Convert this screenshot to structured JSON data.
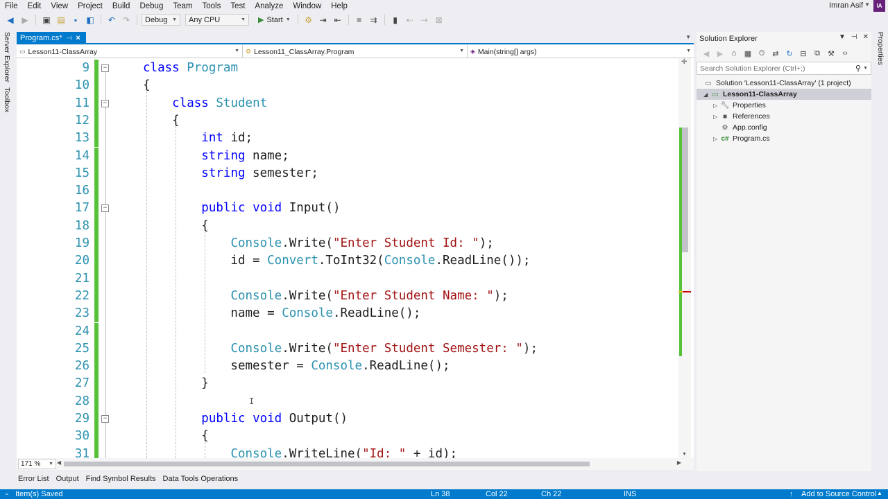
{
  "menu": [
    "File",
    "Edit",
    "View",
    "Project",
    "Build",
    "Debug",
    "Team",
    "Tools",
    "Test",
    "Analyze",
    "Window",
    "Help"
  ],
  "user": {
    "name": "Imran Asif",
    "initials": "IA"
  },
  "toolbar": {
    "config": "Debug",
    "platform": "Any CPU",
    "start": "Start"
  },
  "side_tabs": {
    "left": [
      "Server Explorer",
      "Toolbox"
    ],
    "right": "Properties"
  },
  "document_tab": {
    "label": "Program.cs*"
  },
  "navbar": {
    "project": "Lesson11-ClassArray",
    "type": "Lesson11_ClassArray.Program",
    "member": "Main(string[] args)"
  },
  "editor": {
    "lines": [
      {
        "n": "9",
        "tokens": [
          [
            "kw",
            "class"
          ],
          [
            "t",
            " "
          ],
          [
            "ty",
            "Program"
          ]
        ]
      },
      {
        "n": "10",
        "tokens": [
          [
            "t",
            "{"
          ]
        ]
      },
      {
        "n": "11",
        "tokens": [
          [
            "t",
            "    "
          ],
          [
            "kw",
            "class"
          ],
          [
            "t",
            " "
          ],
          [
            "ty",
            "Student"
          ]
        ]
      },
      {
        "n": "12",
        "tokens": [
          [
            "t",
            "    {"
          ]
        ]
      },
      {
        "n": "13",
        "tokens": [
          [
            "t",
            "        "
          ],
          [
            "kw",
            "int"
          ],
          [
            "t",
            " id;"
          ]
        ]
      },
      {
        "n": "14",
        "tokens": [
          [
            "t",
            "        "
          ],
          [
            "kw",
            "string"
          ],
          [
            "t",
            " name;"
          ]
        ]
      },
      {
        "n": "15",
        "tokens": [
          [
            "t",
            "        "
          ],
          [
            "kw",
            "string"
          ],
          [
            "t",
            " semester;"
          ]
        ]
      },
      {
        "n": "16",
        "tokens": []
      },
      {
        "n": "17",
        "tokens": [
          [
            "t",
            "        "
          ],
          [
            "kw",
            "public"
          ],
          [
            "t",
            " "
          ],
          [
            "kw",
            "void"
          ],
          [
            "t",
            " Input()"
          ]
        ]
      },
      {
        "n": "18",
        "tokens": [
          [
            "t",
            "        {"
          ]
        ]
      },
      {
        "n": "19",
        "tokens": [
          [
            "t",
            "            "
          ],
          [
            "ty",
            "Console"
          ],
          [
            "t",
            ".Write("
          ],
          [
            "str",
            "\"Enter Student Id: \""
          ],
          [
            "t",
            ");"
          ]
        ]
      },
      {
        "n": "20",
        "tokens": [
          [
            "t",
            "            id = "
          ],
          [
            "ty",
            "Convert"
          ],
          [
            "t",
            ".ToInt32("
          ],
          [
            "ty",
            "Console"
          ],
          [
            "t",
            ".ReadLine());"
          ]
        ]
      },
      {
        "n": "21",
        "tokens": []
      },
      {
        "n": "22",
        "tokens": [
          [
            "t",
            "            "
          ],
          [
            "ty",
            "Console"
          ],
          [
            "t",
            ".Write("
          ],
          [
            "str",
            "\"Enter Student Name: \""
          ],
          [
            "t",
            ");"
          ]
        ]
      },
      {
        "n": "23",
        "tokens": [
          [
            "t",
            "            name = "
          ],
          [
            "ty",
            "Console"
          ],
          [
            "t",
            ".ReadLine();"
          ]
        ]
      },
      {
        "n": "24",
        "tokens": []
      },
      {
        "n": "25",
        "tokens": [
          [
            "t",
            "            "
          ],
          [
            "ty",
            "Console"
          ],
          [
            "t",
            ".Write("
          ],
          [
            "str",
            "\"Enter Student Semester: \""
          ],
          [
            "t",
            ");"
          ]
        ]
      },
      {
        "n": "26",
        "tokens": [
          [
            "t",
            "            semester = "
          ],
          [
            "ty",
            "Console"
          ],
          [
            "t",
            ".ReadLine();"
          ]
        ]
      },
      {
        "n": "27",
        "tokens": [
          [
            "t",
            "        }"
          ]
        ]
      },
      {
        "n": "28",
        "tokens": []
      },
      {
        "n": "29",
        "tokens": [
          [
            "t",
            "        "
          ],
          [
            "kw",
            "public"
          ],
          [
            "t",
            " "
          ],
          [
            "kw",
            "void"
          ],
          [
            "t",
            " Output()"
          ]
        ]
      },
      {
        "n": "30",
        "tokens": [
          [
            "t",
            "        {"
          ]
        ]
      },
      {
        "n": "31",
        "tokens": [
          [
            "t",
            "            "
          ],
          [
            "ty",
            "Console"
          ],
          [
            "t",
            ".WriteLine("
          ],
          [
            "str",
            "\"Id: \""
          ],
          [
            "t",
            " + id);"
          ]
        ]
      }
    ],
    "collapsible_lines": [
      "9",
      "11",
      "17",
      "29"
    ],
    "zoom": "171 %"
  },
  "tool_tabs": [
    "Error List",
    "Output",
    "Find Symbol Results",
    "Data Tools Operations"
  ],
  "status": {
    "message": "Item(s) Saved",
    "ln": "Ln 38",
    "col": "Col 22",
    "ch": "Ch 22",
    "mode": "INS",
    "source_control": "Add to Source Control"
  },
  "solution_explorer": {
    "title": "Solution Explorer",
    "search_placeholder": "Search Solution Explorer (Ctrl+;)",
    "solution": "Solution 'Lesson11-ClassArray' (1 project)",
    "project": "Lesson11-ClassArray",
    "items": [
      "Properties",
      "References",
      "App.config",
      "Program.cs"
    ]
  },
  "colors": {
    "accent": "#007acc",
    "keyword": "#0000ff",
    "type": "#2b91af",
    "string": "#a31515",
    "change_bar": "#57c13a"
  }
}
